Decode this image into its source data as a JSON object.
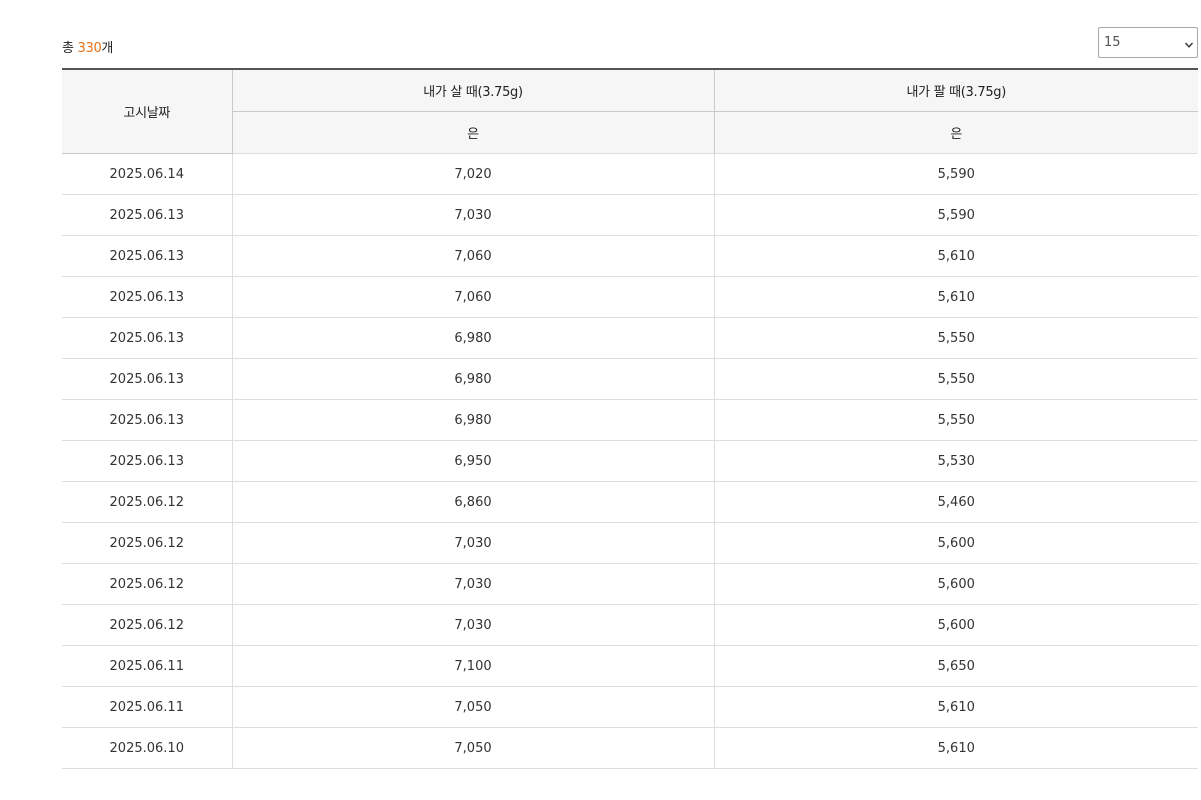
{
  "summary": {
    "prefix": "총 ",
    "count": "330",
    "suffix": "개"
  },
  "page_size": {
    "selected": "15"
  },
  "table": {
    "headers": {
      "date": "고시날짜",
      "buy": "내가 살 때(3.75g)",
      "sell": "내가 팔 때(3.75g)",
      "buy_sub": "은",
      "sell_sub": "은"
    },
    "rows": [
      {
        "date": "2025.06.14",
        "buy": "7,020",
        "sell": "5,590"
      },
      {
        "date": "2025.06.13",
        "buy": "7,030",
        "sell": "5,590"
      },
      {
        "date": "2025.06.13",
        "buy": "7,060",
        "sell": "5,610"
      },
      {
        "date": "2025.06.13",
        "buy": "7,060",
        "sell": "5,610"
      },
      {
        "date": "2025.06.13",
        "buy": "6,980",
        "sell": "5,550"
      },
      {
        "date": "2025.06.13",
        "buy": "6,980",
        "sell": "5,550"
      },
      {
        "date": "2025.06.13",
        "buy": "6,980",
        "sell": "5,550"
      },
      {
        "date": "2025.06.13",
        "buy": "6,950",
        "sell": "5,530"
      },
      {
        "date": "2025.06.12",
        "buy": "6,860",
        "sell": "5,460"
      },
      {
        "date": "2025.06.12",
        "buy": "7,030",
        "sell": "5,600"
      },
      {
        "date": "2025.06.12",
        "buy": "7,030",
        "sell": "5,600"
      },
      {
        "date": "2025.06.12",
        "buy": "7,030",
        "sell": "5,600"
      },
      {
        "date": "2025.06.11",
        "buy": "7,100",
        "sell": "5,650"
      },
      {
        "date": "2025.06.11",
        "buy": "7,050",
        "sell": "5,610"
      },
      {
        "date": "2025.06.10",
        "buy": "7,050",
        "sell": "5,610"
      }
    ]
  },
  "colors": {
    "accent": "#e8731a",
    "header_bg": "#f6f6f6",
    "header_rule": "#555555"
  },
  "icons": {
    "dropdown": "chevron-down-icon"
  }
}
